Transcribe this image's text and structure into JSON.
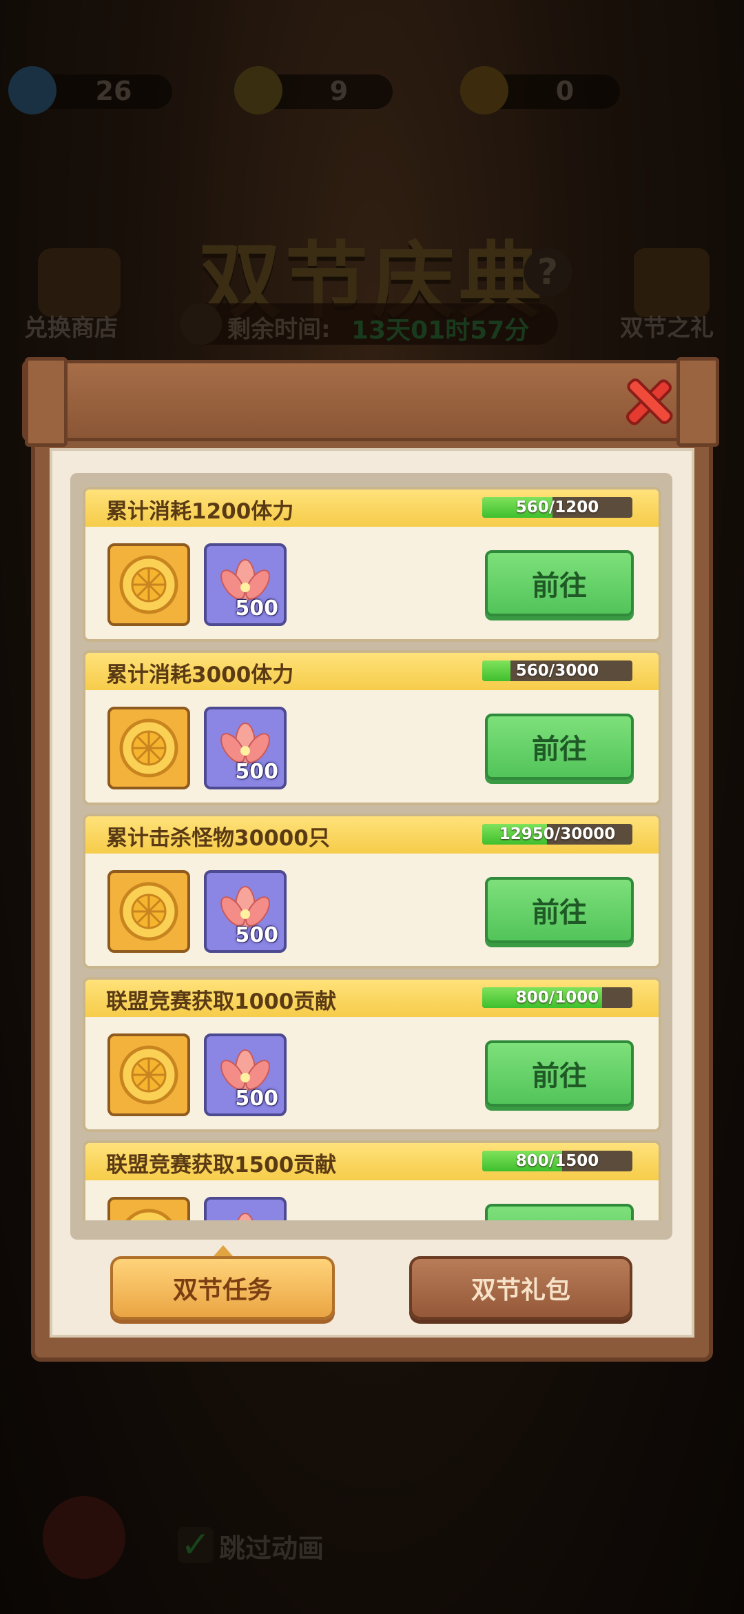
{
  "background": {
    "resources": [
      {
        "icon": "diamond-icon",
        "value": "26"
      },
      {
        "icon": "frog-icon",
        "value": "9"
      },
      {
        "icon": "mooncake-icon",
        "value": "0"
      }
    ],
    "event_title": "双节庆典",
    "shop_label": "兑换商店",
    "gift_label": "双节之礼",
    "timer_label": "剩余时间:",
    "timer_value": "13天01时57分",
    "skip_label": "跳过动画"
  },
  "tasks": [
    {
      "title": "累计消耗1200体力",
      "progress_text": "560/1200",
      "progress": 0.467,
      "rewards": [
        {
          "icon": "mooncake-icon"
        },
        {
          "icon": "lotus-icon",
          "qty": "500"
        }
      ],
      "button": "前往"
    },
    {
      "title": "累计消耗3000体力",
      "progress_text": "560/3000",
      "progress": 0.187,
      "rewards": [
        {
          "icon": "mooncake-icon"
        },
        {
          "icon": "lotus-icon",
          "qty": "500"
        }
      ],
      "button": "前往"
    },
    {
      "title": "累计击杀怪物30000只",
      "progress_text": "12950/30000",
      "progress": 0.432,
      "rewards": [
        {
          "icon": "mooncake-icon"
        },
        {
          "icon": "lotus-icon",
          "qty": "500"
        }
      ],
      "button": "前往"
    },
    {
      "title": "联盟竞赛获取1000贡献",
      "progress_text": "800/1000",
      "progress": 0.8,
      "rewards": [
        {
          "icon": "mooncake-icon"
        },
        {
          "icon": "lotus-icon",
          "qty": "500"
        }
      ],
      "button": "前往"
    },
    {
      "title": "联盟竞赛获取1500贡献",
      "progress_text": "800/1500",
      "progress": 0.533,
      "rewards": [
        {
          "icon": "mooncake-icon"
        },
        {
          "icon": "lotus-icon",
          "qty": "500"
        }
      ],
      "button": "前往"
    }
  ],
  "tabs": {
    "active": "双节任务",
    "inactive": "双节礼包"
  },
  "colors": {
    "progress_fill": "#4fcf38",
    "go_button": "#5bc962",
    "frame": "#8b5a3a",
    "paper": "#f3eadb"
  }
}
